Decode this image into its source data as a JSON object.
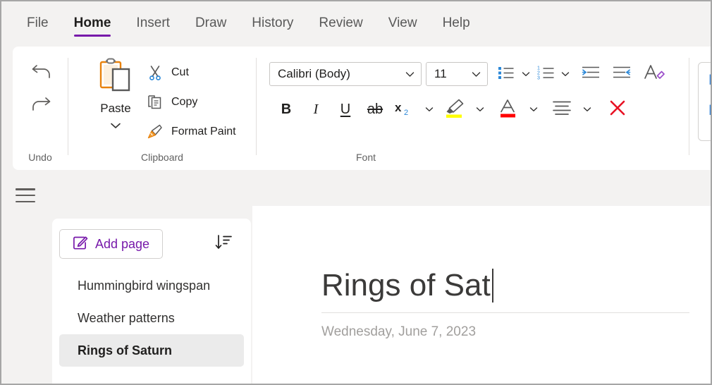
{
  "ribbon": {
    "tabs": [
      {
        "label": "File",
        "active": false
      },
      {
        "label": "Home",
        "active": true
      },
      {
        "label": "Insert",
        "active": false
      },
      {
        "label": "Draw",
        "active": false
      },
      {
        "label": "History",
        "active": false
      },
      {
        "label": "Review",
        "active": false
      },
      {
        "label": "View",
        "active": false
      },
      {
        "label": "Help",
        "active": false
      }
    ],
    "accent_color": "#7719aa",
    "groups": {
      "undo": {
        "label": "Undo",
        "undo_icon": "undo-arrow-icon",
        "redo_icon": "redo-arrow-icon"
      },
      "clipboard": {
        "label": "Clipboard",
        "paste_label": "Paste",
        "paste_icon": "clipboard-paste-icon",
        "items": [
          {
            "label": "Cut",
            "icon": "scissors-icon"
          },
          {
            "label": "Copy",
            "icon": "copy-documents-icon"
          },
          {
            "label": "Format Paint",
            "icon": "format-painter-brush-icon"
          }
        ]
      },
      "font": {
        "label": "Font",
        "font_name": "Calibri (Body)",
        "font_size": "11",
        "buttons": [
          {
            "name": "bullets",
            "glyph": "•",
            "icon": "bulleted-list-icon"
          },
          {
            "name": "numbering",
            "glyph": "1.",
            "icon": "numbered-list-icon"
          },
          {
            "name": "decrease-indent",
            "icon": "decrease-indent-icon"
          },
          {
            "name": "increase-indent",
            "icon": "increase-indent-icon"
          },
          {
            "name": "clear-formatting",
            "icon": "clear-formatting-icon"
          },
          {
            "name": "bold",
            "glyph": "B",
            "icon": "bold-icon"
          },
          {
            "name": "italic",
            "glyph": "I",
            "icon": "italic-icon"
          },
          {
            "name": "underline",
            "glyph": "U",
            "icon": "underline-icon"
          },
          {
            "name": "strikethrough",
            "glyph": "ab",
            "icon": "strikethrough-icon"
          },
          {
            "name": "subscript",
            "glyph": "x₂",
            "icon": "subscript-icon"
          },
          {
            "name": "highlight",
            "icon": "highlighter-icon",
            "color": "#ffff00"
          },
          {
            "name": "font-color",
            "glyph": "A",
            "icon": "font-color-icon",
            "color": "#ff0000"
          },
          {
            "name": "alignment",
            "icon": "align-icon"
          },
          {
            "name": "clear-all-formatting",
            "icon": "red-x-icon",
            "color": "#e81123"
          }
        ]
      },
      "styles": {
        "items": [
          "H",
          "H"
        ],
        "color": "#2b7cd3"
      }
    }
  },
  "navigation": {
    "menu_icon": "hamburger-menu-icon"
  },
  "page_panel": {
    "add_page_label": "Add page",
    "add_page_icon": "edit-square-icon",
    "sort_icon": "sort-descending-icon",
    "pages": [
      {
        "label": "Hummingbird wingspan",
        "selected": false
      },
      {
        "label": "Weather patterns",
        "selected": false
      },
      {
        "label": "Rings of Saturn",
        "selected": true
      }
    ]
  },
  "content": {
    "title": "Rings of Sat",
    "date": "Wednesday, June 7, 2023"
  }
}
